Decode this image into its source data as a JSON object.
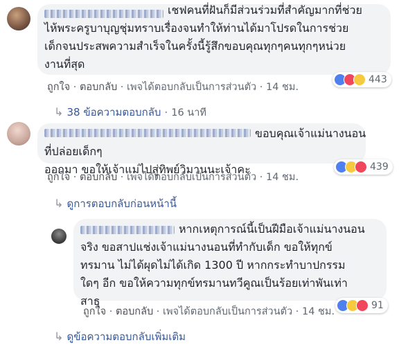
{
  "comments": [
    {
      "text": "เชฟคนที่ฝันก็มีส่วนร่วมที่สำคัญมากที่ช่วย\nไห้พระครูบาบุญชุ่มทราบเรื่องจนทำให้ท่านได้มาโปรดในการช่วย\nเด็กจนประสพความสำเร็จในครั้งนี้รู้สึกขอบคุณทุกๆคนทุกๆหน่วย\nงานที่สุด",
      "reactions_count": "443",
      "like": "ถูกใจ",
      "reply": "ตอบกลับ",
      "author_note": "เพจได้ตอบกลับเป็นการส่วนตัว",
      "time": "14 ชม.",
      "replies_link": "38 ข้อความตอบกลับ",
      "replies_time": "16 นาที"
    },
    {
      "text": "ขอบคุณเจ้าแม่นางนอนที่ปล่อยเด็กๆ\nออกมา ขอให้เจ้าแม่ไปสู่ทิพย์วิมานนะเจ้าคะ",
      "reactions_count": "439",
      "like": "ถูกใจ",
      "reply": "ตอบกลับ",
      "author_note": "เพจได้ตอบกลับเป็นการส่วนตัว",
      "time": "14 ชม.",
      "previous_link": "ดูการตอบกลับก่อนหน้านี้"
    },
    {
      "text": "หากเหตุการณ์นี้เป็นฝีมือเจ้าแม่นางนอน\nจริง ขอสาปแช่งเจ้าแม่นางนอนที่ทำกับเด็ก ขอให้ทุกข์\nทรมาน ไม่ได้ผุดไม่ได้เกิด 1300 ปี หากกระทำบาปกรรม\nใดๆ อีก ขอให้ความทุกข์ทรมานทวีคูณเป็นร้อยเท่าพันเท่า\nสาธุ",
      "reactions_count": "91",
      "like": "ถูกใจ",
      "reply": "ตอบกลับ",
      "author_note": "เพจได้ตอบกลับเป็นการส่วนตัว",
      "time": "14 ชม."
    }
  ],
  "more_link": "ดูข้อความตอบกลับเพิ่มเติม",
  "separator": "·",
  "colors": {
    "link": "#385898",
    "bubble": "#f2f3f5",
    "meta": "#606770",
    "text": "#1d2129"
  },
  "icons": [
    "like-icon",
    "love-icon",
    "haha-icon",
    "wow-icon",
    "reply-arrow-icon"
  ]
}
